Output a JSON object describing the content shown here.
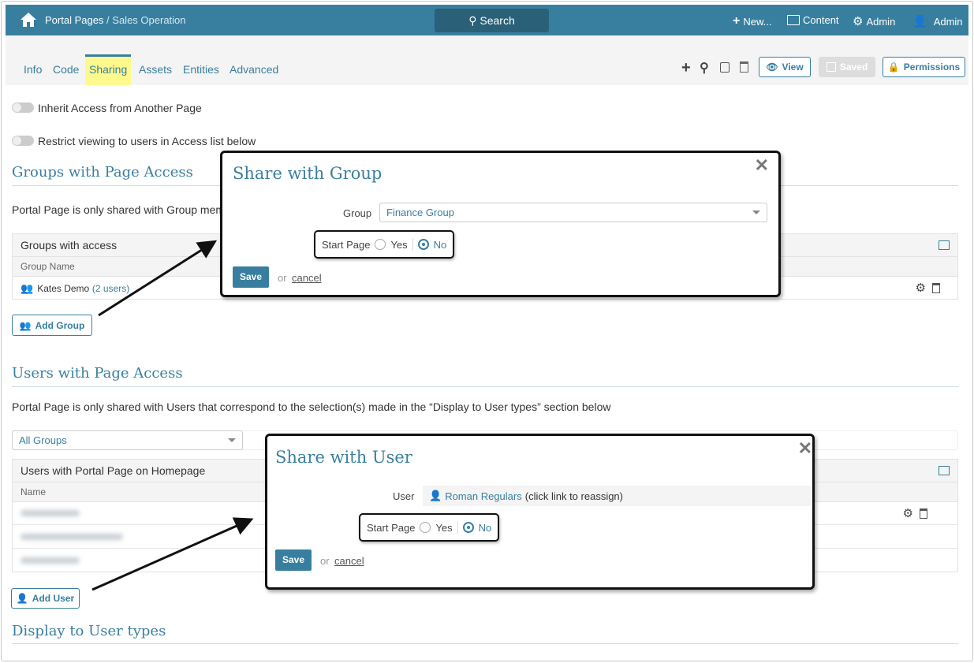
{
  "topbar": {
    "breadcrumb_root": "Portal Pages",
    "breadcrumb_sep": " / ",
    "breadcrumb_page": "Sales Operation",
    "search": "Search",
    "new": "New...",
    "content": "Content",
    "admin_settings": "Admin",
    "admin_user": "Admin"
  },
  "tabs": [
    "Info",
    "Code",
    "Sharing",
    "Assets",
    "Entities",
    "Advanced"
  ],
  "toolbar": {
    "view": "View",
    "saved": "Saved",
    "permissions": "Permissions"
  },
  "toggles": {
    "inherit": "Inherit Access from Another Page",
    "restrict": "Restrict viewing to users in Access list below"
  },
  "groups": {
    "heading": "Groups with Page Access",
    "note": "Portal Page is only shared with Group members",
    "table_title": "Groups with access",
    "col_name": "Group Name",
    "rows": [
      {
        "name": "Kates Demo",
        "count": "(2 users)"
      }
    ],
    "add_button": "Add Group"
  },
  "users": {
    "heading": "Users with Page Access",
    "note": "Portal Page is only shared with Users that correspond to the selection(s) made in the “Display to User types” section below",
    "filter": "All Groups",
    "table_title": "Users with Portal Page on Homepage",
    "col_name": "Name",
    "add_button": "Add User"
  },
  "display_heading": "Display to User types",
  "group_modal": {
    "title": "Share with Group",
    "group_label": "Group",
    "group_value": "Finance Group",
    "start_label": "Start Page",
    "yes": "Yes",
    "no": "No",
    "selected": "No",
    "save": "Save",
    "or": "or",
    "cancel": "cancel"
  },
  "user_modal": {
    "title": "Share with User",
    "user_label": "User",
    "user_value": "Roman Regulars",
    "user_hint": "(click link to reassign)",
    "start_label": "Start Page",
    "yes": "Yes",
    "no": "No",
    "selected": "No",
    "save": "Save",
    "or": "or",
    "cancel": "cancel"
  }
}
